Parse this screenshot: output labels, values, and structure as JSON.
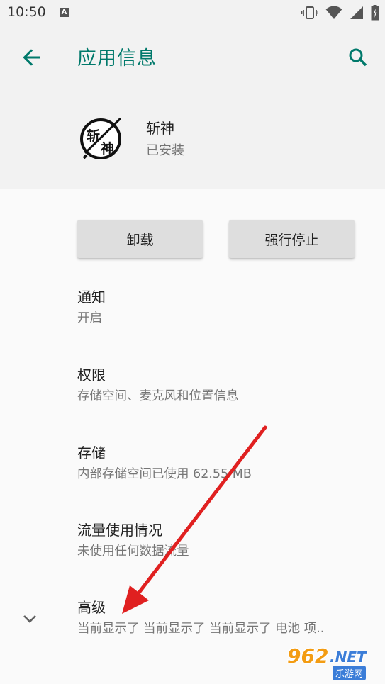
{
  "status_bar": {
    "time": "10:50",
    "notification_glyph": "A",
    "icons": [
      "vibrate-icon",
      "wifi-icon",
      "signal-icon",
      "battery-charging-icon"
    ]
  },
  "header": {
    "title": "应用信息",
    "accent_color": "#00796b"
  },
  "app": {
    "name": "斩神",
    "status": "已安装",
    "icon_glyphs": [
      "斩",
      "神"
    ]
  },
  "actions": {
    "uninstall_label": "卸载",
    "force_stop_label": "强行停止"
  },
  "preferences": [
    {
      "title": "通知",
      "summary": "开启"
    },
    {
      "title": "权限",
      "summary": "存储空间、麦克风和位置信息"
    },
    {
      "title": "存储",
      "summary": "内部存储空间已使用 62.55 MB"
    },
    {
      "title": "流量使用情况",
      "summary": "未使用任何数据流量"
    },
    {
      "title": "高级",
      "summary": "当前显示了 当前显示了 当前显示了 电池 项.."
    }
  ],
  "watermark": {
    "number": "962",
    "suffix": ".NET",
    "site_name": "乐游网"
  }
}
